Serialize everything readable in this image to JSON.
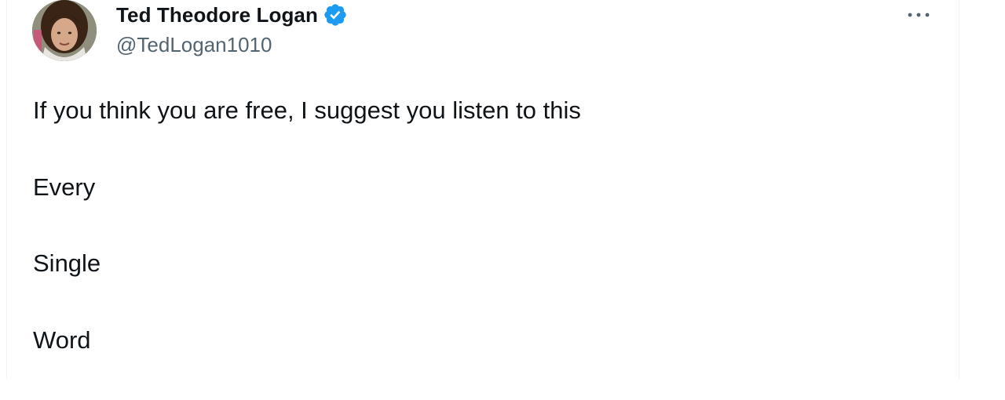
{
  "author": {
    "display_name": "Ted Theodore Logan",
    "handle": "@TedLogan1010",
    "verified": true
  },
  "icons": {
    "verified": "verified-badge-icon",
    "more": "more-options-icon",
    "avatar": "profile-photo"
  },
  "tweet": {
    "lines": [
      "If you think you are free, I suggest you listen to this",
      "Every",
      "Single",
      "Word"
    ]
  },
  "colors": {
    "text": "#0f1419",
    "secondary": "#536471",
    "verified_blue": "#1d9bf0",
    "border": "#eff3f4"
  }
}
